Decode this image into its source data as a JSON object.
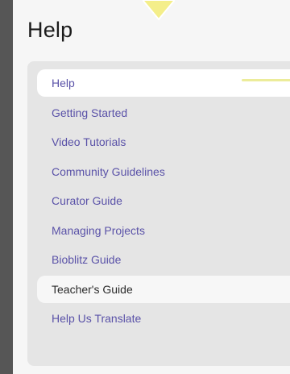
{
  "page": {
    "title": "Help"
  },
  "menu": {
    "items": [
      {
        "label": "Help"
      },
      {
        "label": "Getting Started"
      },
      {
        "label": "Video Tutorials"
      },
      {
        "label": "Community Guidelines"
      },
      {
        "label": "Curator Guide"
      },
      {
        "label": "Managing Projects"
      },
      {
        "label": "Bioblitz Guide"
      },
      {
        "label": "Teacher's Guide"
      },
      {
        "label": "Help Us Translate"
      }
    ]
  },
  "colors": {
    "background": "#565656",
    "panel": "#f6f6f6",
    "menu": "#e5e5e5",
    "link": "#5a52a8",
    "pointer": "#f4ee8a"
  },
  "icons": {
    "pointer": "down-arrow-icon"
  }
}
